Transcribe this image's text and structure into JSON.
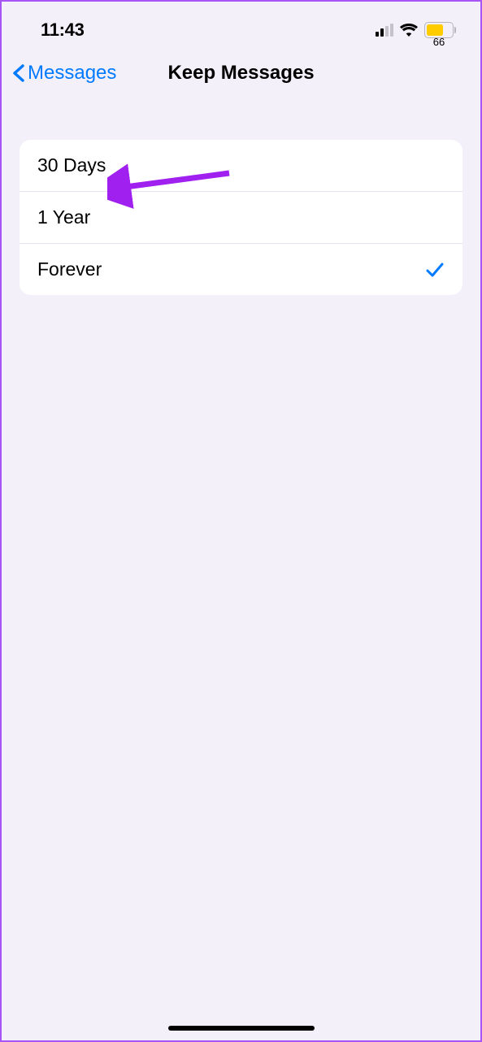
{
  "status_bar": {
    "time": "11:43",
    "battery_percent": "66"
  },
  "nav": {
    "back_label": "Messages",
    "title": "Keep Messages"
  },
  "options": [
    {
      "label": "30 Days",
      "selected": false
    },
    {
      "label": "1 Year",
      "selected": false
    },
    {
      "label": "Forever",
      "selected": true
    }
  ]
}
